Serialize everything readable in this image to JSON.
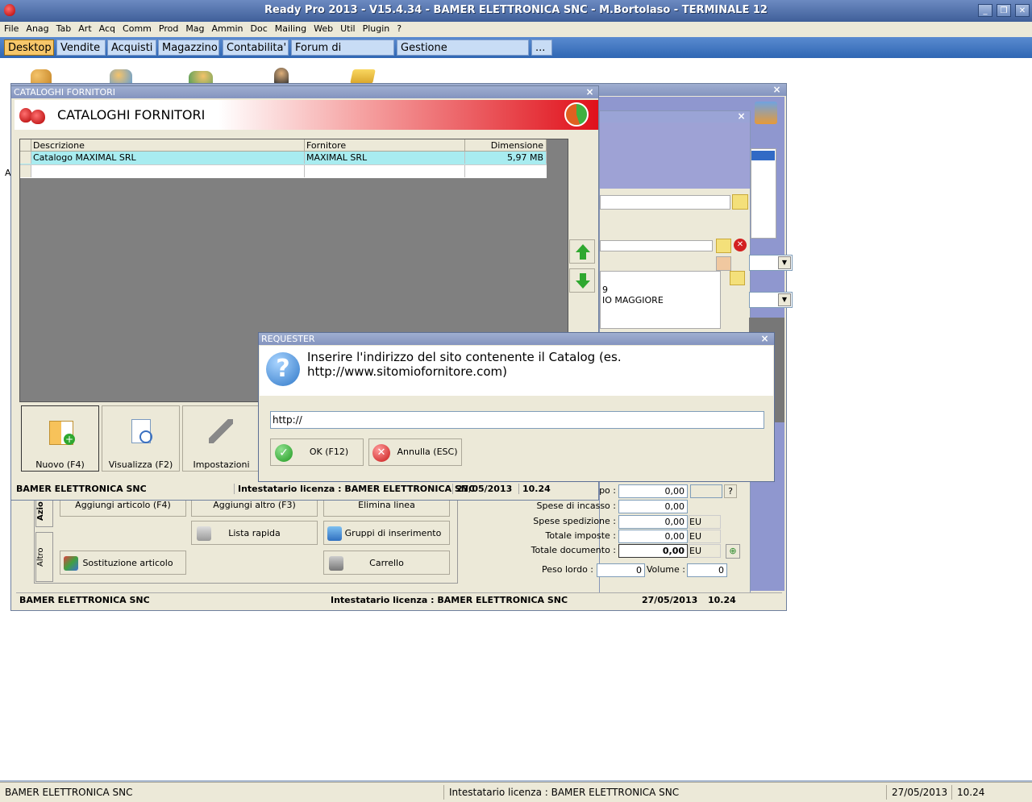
{
  "app": {
    "title": "Ready Pro 2013 - V15.4.34 - BAMER ELETTRONICA SNC - M.Bortolaso - TERMINALE 12",
    "minimize": "_",
    "restore": "❐",
    "close": "✕"
  },
  "menu": [
    "File",
    "Anag",
    "Tab",
    "Art",
    "Acq",
    "Comm",
    "Prod",
    "Mag",
    "Ammin",
    "Doc",
    "Mailing",
    "Web",
    "Util",
    "Plugin",
    "?"
  ],
  "tabs": [
    "Desktop",
    "Vendite",
    "Acquisti",
    "Magazzino",
    "Contabilita'",
    "Forum di supporto",
    "Gestione messaggistica",
    "..."
  ],
  "catalog_window": {
    "title": "CATALOGHI FORNITORI",
    "header": "CATALOGHI FORNITORI",
    "columns": [
      "Descrizione",
      "Fornitore",
      "Dimensione"
    ],
    "rows": [
      {
        "descrizione": "Catalogo MAXIMAL SRL",
        "fornitore": "MAXIMAL SRL",
        "dimensione": "5,97 MB"
      }
    ],
    "buttons": {
      "nuovo": "Nuovo (F4)",
      "visualizza": "Visualizza (F2)",
      "impostazioni": "Impostazioni"
    },
    "status": {
      "company": "BAMER ELETTRONICA SNC",
      "license": "Intestatario licenza : BAMER ELETTRONICA SNC",
      "date": "27/05/2013",
      "time": "10.24"
    }
  },
  "background_window": {
    "address_line1": "9",
    "address_line2": "IO MAGGIORE",
    "actions_tab": "Azio",
    "other_tab": "Altro",
    "buttons": {
      "aggiungi_articolo": "Aggiungi articolo (F4)",
      "aggiungi_altro": "Aggiungi altro (F3)",
      "elimina_linea": "Elimina linea",
      "lista_rapida": "Lista rapida",
      "gruppi_inserimento": "Gruppi di inserimento",
      "sostituzione_articolo": "Sostituzione articolo",
      "carrello": "Carrello"
    },
    "totals": {
      "label_top": "po :",
      "value_top": "0,00",
      "help": "?",
      "spese_incasso_label": "Spese di incasso :",
      "spese_incasso": "0,00",
      "spese_spedizione_label": "Spese spedizione :",
      "spese_spedizione": "0,00",
      "totale_imposte_label": "Totale imposte :",
      "totale_imposte": "0,00",
      "totale_documento_label": "Totale documento :",
      "totale_documento": "0,00",
      "currency": "EU",
      "peso_lordo_label": "Peso lordo :",
      "peso_lordo": "0",
      "volume_label": "Volume :",
      "volume": "0"
    },
    "status": {
      "company": "BAMER ELETTRONICA SNC",
      "license": "Intestatario licenza : BAMER ELETTRONICA SNC",
      "date": "27/05/2013",
      "time": "10.24"
    }
  },
  "requester": {
    "title": "REQUESTER",
    "message": "Inserire l'indirizzo del sito contenente il Catalog (es. http://www.sitomiofornitore.com)",
    "input_value": "http://",
    "ok": "OK (F12)",
    "cancel": "Annulla (ESC)"
  },
  "desktop_letter_a": "A",
  "statusbar": {
    "company": "BAMER ELETTRONICA SNC",
    "license": "Intestatario licenza : BAMER ELETTRONICA SNC",
    "date": "27/05/2013",
    "time": "10.24"
  },
  "colors": {
    "titlebar": "#3f5f99",
    "tabbar": "#2f66b3",
    "active_tab": "#f7c76a",
    "selected_row": "#a8ecf0",
    "header_red": "#e0101a"
  }
}
